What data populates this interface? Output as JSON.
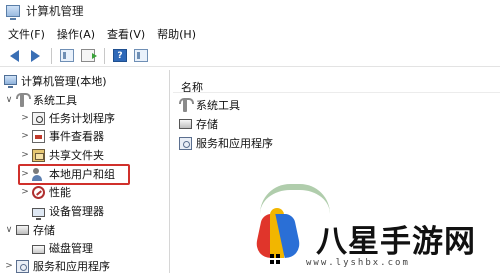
{
  "window": {
    "title": "计算机管理"
  },
  "menu": [
    "文件(F)",
    "操作(A)",
    "查看(V)",
    "帮助(H)"
  ],
  "toolbar": {
    "help_glyph": "?"
  },
  "tree": {
    "root": "计算机管理(本地)",
    "items": [
      {
        "label": "系统工具",
        "chevron": "∨",
        "icon": "tools-icon"
      },
      {
        "label": "任务计划程序",
        "chevron": ">",
        "icon": "task-scheduler-icon"
      },
      {
        "label": "事件查看器",
        "chevron": ">",
        "icon": "event-viewer-icon"
      },
      {
        "label": "共享文件夹",
        "chevron": ">",
        "icon": "shared-folder-icon"
      },
      {
        "label": "本地用户和组",
        "chevron": ">",
        "icon": "users-icon",
        "selected": true
      },
      {
        "label": "性能",
        "chevron": ">",
        "icon": "performance-icon"
      },
      {
        "label": "设备管理器",
        "chevron": "",
        "icon": "device-manager-icon"
      },
      {
        "label": "存储",
        "chevron": "∨",
        "icon": "storage-icon"
      },
      {
        "label": "磁盘管理",
        "chevron": "",
        "icon": "disk-icon"
      },
      {
        "label": "服务和应用程序",
        "chevron": ">",
        "icon": "services-icon"
      }
    ]
  },
  "right": {
    "column_header": "名称",
    "items": [
      "系统工具",
      "存储",
      "服务和应用程序"
    ]
  },
  "watermark": {
    "brand": "八星手游网",
    "url": "www.lyshbx.com"
  },
  "colors": {
    "selection_border": "#d0302b",
    "accent": "#3a6fb5"
  }
}
